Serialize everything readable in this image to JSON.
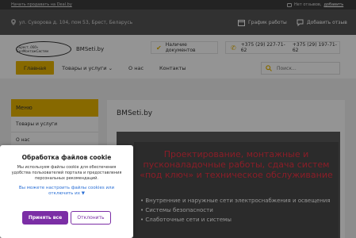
{
  "topbar": {
    "start_link": "Начать продавать на Deal.by",
    "no_reviews": "Нет отзывов,",
    "add_link": "добавить"
  },
  "addrbar": {
    "address": "ул. Суворова д. 104, пом 53, Брест, Беларусь",
    "work_hours": "График работы",
    "add_review": "Добавить отзыв"
  },
  "header": {
    "logo_text": "«Брест, 000» БелМонтажСистем",
    "site_name": "BMSeti.by",
    "docs_label": "Наличие документов",
    "phone1": "+375 (29) 227-71-62",
    "phone2": "+375 (29) 197-71-62",
    "search_placeholder": "Поиск..."
  },
  "nav": [
    {
      "label": "Главная"
    },
    {
      "label": "Товары и услуги"
    },
    {
      "label": "О нас"
    },
    {
      "label": "Контакты"
    }
  ],
  "sidebar": {
    "title": "Меню",
    "items": [
      {
        "label": "Товары и услуги"
      },
      {
        "label": "О нас"
      }
    ]
  },
  "main": {
    "page_title": "BMSeti.by",
    "hero_title": "Проектирование, монтажные и пусконаладочные работы, сдача систем «под ключ» и техническое обслуживание",
    "bullets": [
      "Внутренние и наружные сети электроснабжения и освещения",
      "Системы безопасности",
      "Слаботочные сети и системы"
    ]
  },
  "cookie": {
    "title": "Обработка файлов cookie",
    "text": "Мы используем файлы cookie для обеспечения удобства пользователей портала и предоставления персональных рекомендаций.",
    "settings_link": "Вы можете настроить файлы cookies или отключить их ▼",
    "accept": "Принять все",
    "reject": "Отклонить"
  },
  "colors": {
    "accent": "#e8b600",
    "cookie_button": "#7b2ea5",
    "hero_title": "#ee3344"
  }
}
